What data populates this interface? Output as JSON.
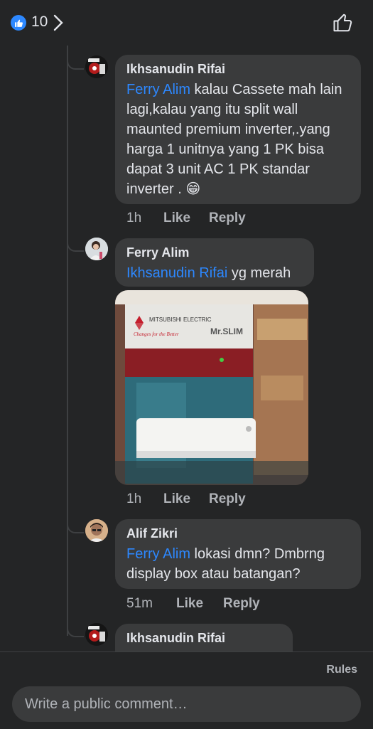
{
  "header": {
    "like_count": "10"
  },
  "comments": [
    {
      "author": "Ikhsanudin Rifai",
      "mention": "Ferry Alim",
      "text": " kalau Cassete mah lain lagi,kalau yang itu split wall maunted premium inverter,.yang harga 1 unitnya yang 1 PK  bisa dapat 3 unit AC 1 PK standar inverter . 😁",
      "time": "1h",
      "like": "Like",
      "reply": "Reply"
    },
    {
      "author": "Ferry Alim",
      "mention": "Ikhsanudin Rifai",
      "text": " yg merah",
      "photo_brand": "MITSUBISHI ELECTRIC",
      "photo_tagline": "Changes for the Better",
      "photo_model": "Mr.SLIM",
      "time": "1h",
      "like": "Like",
      "reply": "Reply"
    },
    {
      "author": "Alif Zikri",
      "mention": "Ferry Alim",
      "text": " lokasi dmn? Dmbrng display box atau batangan?",
      "time": "51m",
      "like": "Like",
      "reply": "Reply"
    },
    {
      "author": "Ikhsanudin Rifai"
    }
  ],
  "footer": {
    "rules": "Rules",
    "placeholder": "Write a public comment…"
  },
  "colors": {
    "background": "#242526",
    "bubble": "#3a3b3c",
    "mention": "#2d88ff",
    "accent": "#2d88ff"
  }
}
